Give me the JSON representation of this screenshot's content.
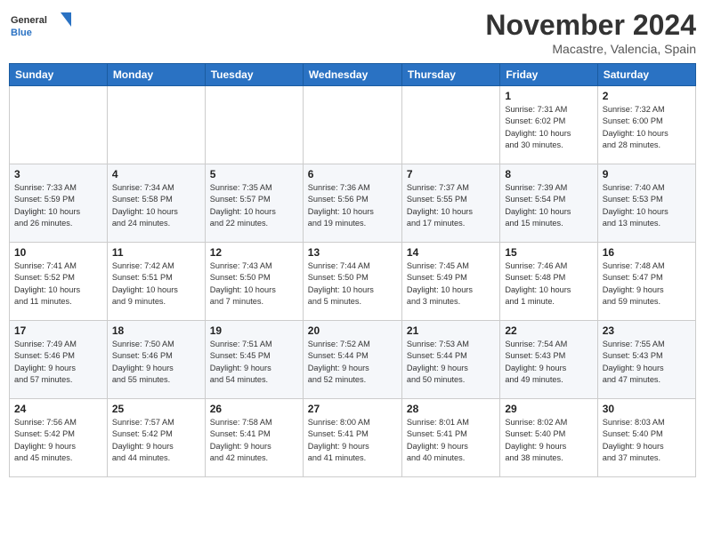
{
  "header": {
    "logo_general": "General",
    "logo_blue": "Blue",
    "month": "November 2024",
    "location": "Macastre, Valencia, Spain"
  },
  "weekdays": [
    "Sunday",
    "Monday",
    "Tuesday",
    "Wednesday",
    "Thursday",
    "Friday",
    "Saturday"
  ],
  "weeks": [
    [
      {
        "day": "",
        "info": ""
      },
      {
        "day": "",
        "info": ""
      },
      {
        "day": "",
        "info": ""
      },
      {
        "day": "",
        "info": ""
      },
      {
        "day": "",
        "info": ""
      },
      {
        "day": "1",
        "info": "Sunrise: 7:31 AM\nSunset: 6:02 PM\nDaylight: 10 hours\nand 30 minutes."
      },
      {
        "day": "2",
        "info": "Sunrise: 7:32 AM\nSunset: 6:00 PM\nDaylight: 10 hours\nand 28 minutes."
      }
    ],
    [
      {
        "day": "3",
        "info": "Sunrise: 7:33 AM\nSunset: 5:59 PM\nDaylight: 10 hours\nand 26 minutes."
      },
      {
        "day": "4",
        "info": "Sunrise: 7:34 AM\nSunset: 5:58 PM\nDaylight: 10 hours\nand 24 minutes."
      },
      {
        "day": "5",
        "info": "Sunrise: 7:35 AM\nSunset: 5:57 PM\nDaylight: 10 hours\nand 22 minutes."
      },
      {
        "day": "6",
        "info": "Sunrise: 7:36 AM\nSunset: 5:56 PM\nDaylight: 10 hours\nand 19 minutes."
      },
      {
        "day": "7",
        "info": "Sunrise: 7:37 AM\nSunset: 5:55 PM\nDaylight: 10 hours\nand 17 minutes."
      },
      {
        "day": "8",
        "info": "Sunrise: 7:39 AM\nSunset: 5:54 PM\nDaylight: 10 hours\nand 15 minutes."
      },
      {
        "day": "9",
        "info": "Sunrise: 7:40 AM\nSunset: 5:53 PM\nDaylight: 10 hours\nand 13 minutes."
      }
    ],
    [
      {
        "day": "10",
        "info": "Sunrise: 7:41 AM\nSunset: 5:52 PM\nDaylight: 10 hours\nand 11 minutes."
      },
      {
        "day": "11",
        "info": "Sunrise: 7:42 AM\nSunset: 5:51 PM\nDaylight: 10 hours\nand 9 minutes."
      },
      {
        "day": "12",
        "info": "Sunrise: 7:43 AM\nSunset: 5:50 PM\nDaylight: 10 hours\nand 7 minutes."
      },
      {
        "day": "13",
        "info": "Sunrise: 7:44 AM\nSunset: 5:50 PM\nDaylight: 10 hours\nand 5 minutes."
      },
      {
        "day": "14",
        "info": "Sunrise: 7:45 AM\nSunset: 5:49 PM\nDaylight: 10 hours\nand 3 minutes."
      },
      {
        "day": "15",
        "info": "Sunrise: 7:46 AM\nSunset: 5:48 PM\nDaylight: 10 hours\nand 1 minute."
      },
      {
        "day": "16",
        "info": "Sunrise: 7:48 AM\nSunset: 5:47 PM\nDaylight: 9 hours\nand 59 minutes."
      }
    ],
    [
      {
        "day": "17",
        "info": "Sunrise: 7:49 AM\nSunset: 5:46 PM\nDaylight: 9 hours\nand 57 minutes."
      },
      {
        "day": "18",
        "info": "Sunrise: 7:50 AM\nSunset: 5:46 PM\nDaylight: 9 hours\nand 55 minutes."
      },
      {
        "day": "19",
        "info": "Sunrise: 7:51 AM\nSunset: 5:45 PM\nDaylight: 9 hours\nand 54 minutes."
      },
      {
        "day": "20",
        "info": "Sunrise: 7:52 AM\nSunset: 5:44 PM\nDaylight: 9 hours\nand 52 minutes."
      },
      {
        "day": "21",
        "info": "Sunrise: 7:53 AM\nSunset: 5:44 PM\nDaylight: 9 hours\nand 50 minutes."
      },
      {
        "day": "22",
        "info": "Sunrise: 7:54 AM\nSunset: 5:43 PM\nDaylight: 9 hours\nand 49 minutes."
      },
      {
        "day": "23",
        "info": "Sunrise: 7:55 AM\nSunset: 5:43 PM\nDaylight: 9 hours\nand 47 minutes."
      }
    ],
    [
      {
        "day": "24",
        "info": "Sunrise: 7:56 AM\nSunset: 5:42 PM\nDaylight: 9 hours\nand 45 minutes."
      },
      {
        "day": "25",
        "info": "Sunrise: 7:57 AM\nSunset: 5:42 PM\nDaylight: 9 hours\nand 44 minutes."
      },
      {
        "day": "26",
        "info": "Sunrise: 7:58 AM\nSunset: 5:41 PM\nDaylight: 9 hours\nand 42 minutes."
      },
      {
        "day": "27",
        "info": "Sunrise: 8:00 AM\nSunset: 5:41 PM\nDaylight: 9 hours\nand 41 minutes."
      },
      {
        "day": "28",
        "info": "Sunrise: 8:01 AM\nSunset: 5:41 PM\nDaylight: 9 hours\nand 40 minutes."
      },
      {
        "day": "29",
        "info": "Sunrise: 8:02 AM\nSunset: 5:40 PM\nDaylight: 9 hours\nand 38 minutes."
      },
      {
        "day": "30",
        "info": "Sunrise: 8:03 AM\nSunset: 5:40 PM\nDaylight: 9 hours\nand 37 minutes."
      }
    ]
  ]
}
